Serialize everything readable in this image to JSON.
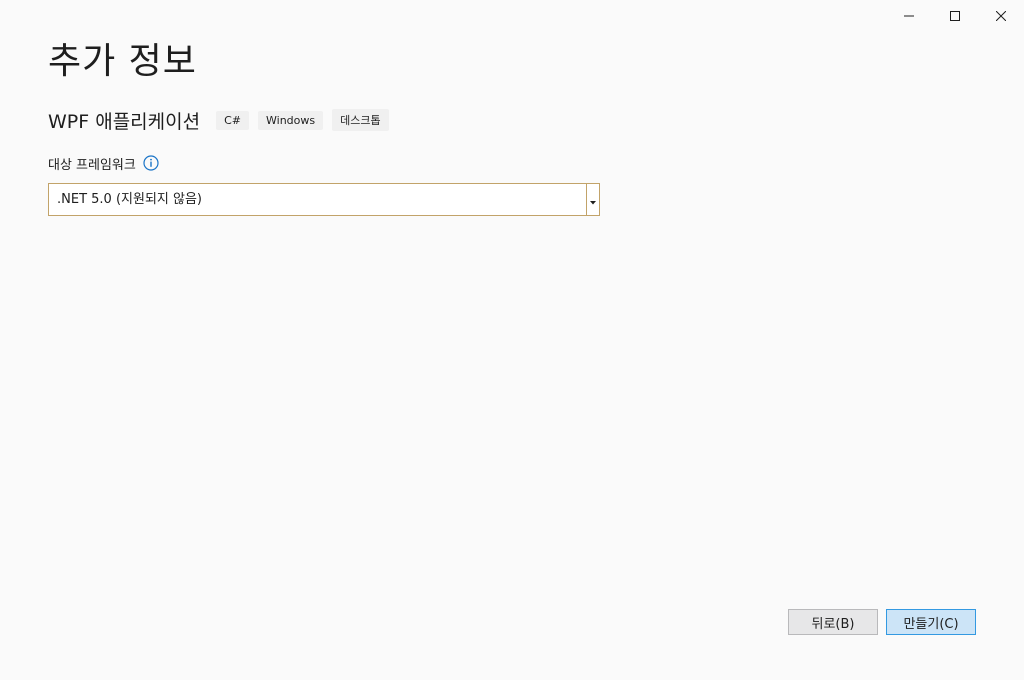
{
  "window": {
    "controls": {
      "minimize_icon": "minimize-icon",
      "maximize_icon": "maximize-icon",
      "close_icon": "close-icon"
    }
  },
  "page": {
    "title": "추가 정보"
  },
  "template": {
    "name": "WPF 애플리케이션",
    "tags": [
      "C#",
      "Windows",
      "데스크톱"
    ]
  },
  "framework": {
    "label": "대상 프레임워크",
    "info_icon": "info-icon",
    "selected_value": ".NET 5.0 (지원되지 않음)"
  },
  "footer": {
    "back_label": "뒤로(B)",
    "create_label": "만들기(C)"
  },
  "colors": {
    "background": "#fafafa",
    "select_border": "#c2a369",
    "primary_button_bg": "#cce4f7",
    "primary_button_border": "#3399e1",
    "info_icon": "#1a74c7"
  }
}
